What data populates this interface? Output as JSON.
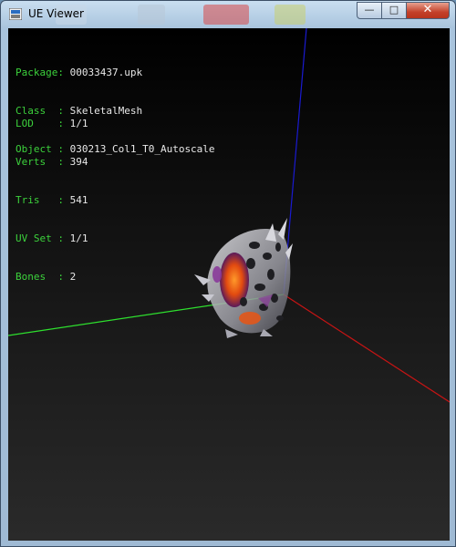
{
  "window": {
    "title": "UE Viewer",
    "minimize_glyph": "—",
    "maximize_glyph": "□",
    "close_glyph": "✕",
    "app_icon": "ue-viewer-icon"
  },
  "colors": {
    "label": "#3cd23c",
    "value": "#e8e8e8",
    "axis_x": "#c81414",
    "axis_y": "#2ee02e",
    "axis_z": "#1a1ad0"
  },
  "object_info": {
    "package_label": "Package:",
    "package": "00033437.upk",
    "class_label": "Class  :",
    "class": "SkeletalMesh",
    "object_label": "Object :",
    "object": "030213_Col1_T0_Autoscale"
  },
  "mesh_stats": {
    "lod_label": "LOD    :",
    "lod": "1/1",
    "verts_label": "Verts  :",
    "verts": "394",
    "tris_label": "Tris   :",
    "tris": "541",
    "uvset_label": "UV Set :",
    "uvset": "1/1",
    "bones_label": "Bones  :",
    "bones": "2"
  }
}
